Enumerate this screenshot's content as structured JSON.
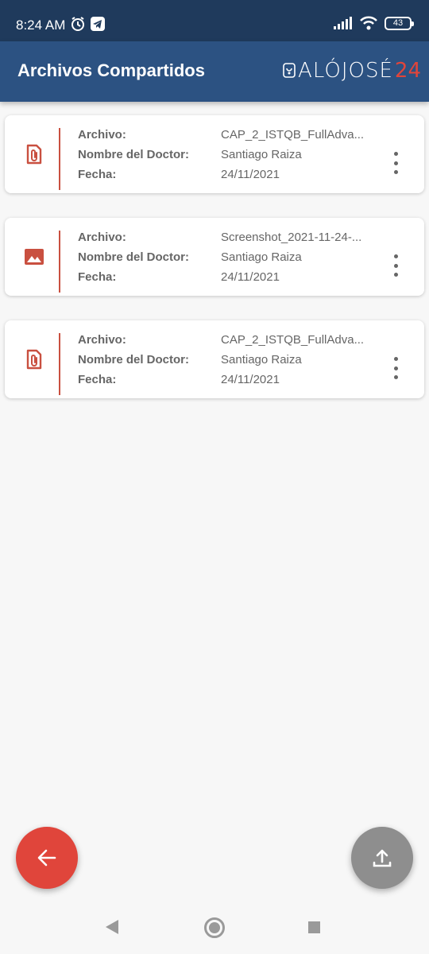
{
  "status": {
    "time": "8:24 AM",
    "battery": "43"
  },
  "header": {
    "title": "Archivos Compartidos",
    "logo_text": "ALÓJOSÉ",
    "logo_number": "24"
  },
  "labels": {
    "archivo": "Archivo:",
    "doctor": "Nombre del Doctor:",
    "fecha": "Fecha:"
  },
  "files": [
    {
      "icon": "attachment-icon",
      "archivo": "CAP_2_ISTQB_FullAdva...",
      "doctor": "Santiago Raiza",
      "fecha": "24/11/2021"
    },
    {
      "icon": "image-icon",
      "archivo": "Screenshot_2021-11-24-...",
      "doctor": "Santiago Raiza",
      "fecha": "24/11/2021"
    },
    {
      "icon": "attachment-icon",
      "archivo": "CAP_2_ISTQB_FullAdva...",
      "doctor": "Santiago Raiza",
      "fecha": "24/11/2021"
    }
  ],
  "colors": {
    "status_bar": "#1f3a5c",
    "app_bar": "#2c5282",
    "accent": "#e0453b",
    "upload_fab": "#8e8e8e",
    "icon": "#c95040"
  }
}
